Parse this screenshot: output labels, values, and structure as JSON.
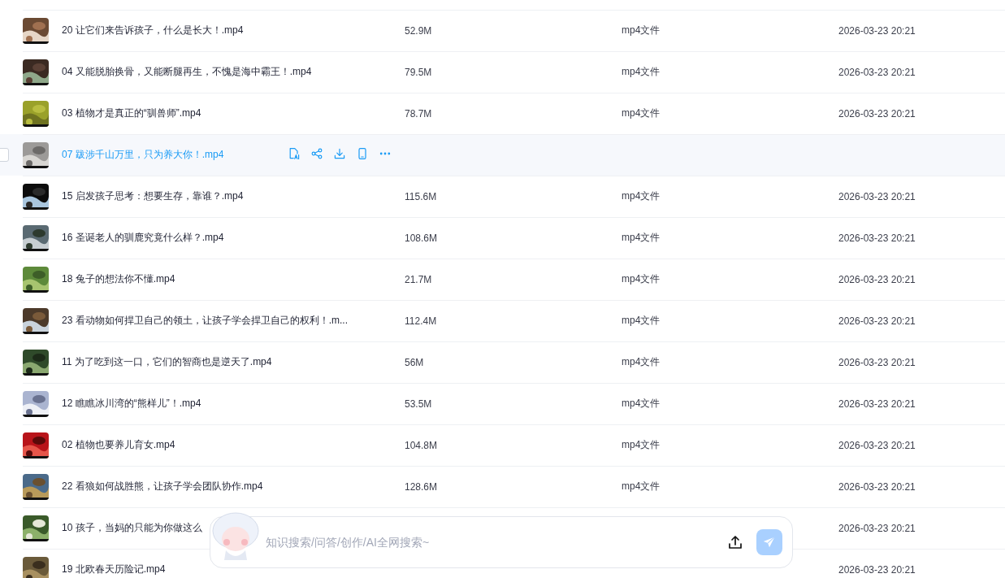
{
  "files": [
    {
      "name": "20 让它们来告诉孩子，什么是长大！.mp4",
      "size": "52.9M",
      "type": "mp4文件",
      "date": "2026-03-23 20:21",
      "hovered": false
    },
    {
      "name": "04 又能脱胎换骨，又能断腿再生，不愧是海中霸王！.mp4",
      "size": "79.5M",
      "type": "mp4文件",
      "date": "2026-03-23 20:21",
      "hovered": false
    },
    {
      "name": "03 植物才是真正的“驯兽师”.mp4",
      "size": "78.7M",
      "type": "mp4文件",
      "date": "2026-03-23 20:21",
      "hovered": false
    },
    {
      "name": "07 跋涉千山万里，只为养大你！.mp4",
      "hovered": true,
      "checked": false
    },
    {
      "name": "15 启发孩子思考：想要生存，靠谁？.mp4",
      "size": "115.6M",
      "type": "mp4文件",
      "date": "2026-03-23 20:21",
      "hovered": false
    },
    {
      "name": "16 圣诞老人的驯鹿究竟什么样？.mp4",
      "size": "108.6M",
      "type": "mp4文件",
      "date": "2026-03-23 20:21",
      "hovered": false
    },
    {
      "name": "18 兔子的想法你不懂.mp4",
      "size": "21.7M",
      "type": "mp4文件",
      "date": "2026-03-23 20:21",
      "hovered": false
    },
    {
      "name": "23 看动物如何捍卫自己的领土，让孩子学会捍卫自己的权利！.m...",
      "size": "112.4M",
      "type": "mp4文件",
      "date": "2026-03-23 20:21",
      "hovered": false
    },
    {
      "name": "11 为了吃到这一口，它们的智商也是逆天了.mp4",
      "size": "56M",
      "type": "mp4文件",
      "date": "2026-03-23 20:21",
      "hovered": false
    },
    {
      "name": "12 瞧瞧冰川湾的“熊样儿”！.mp4",
      "size": "53.5M",
      "type": "mp4文件",
      "date": "2026-03-23 20:21",
      "hovered": false
    },
    {
      "name": "02 植物也要养儿育女.mp4",
      "size": "104.8M",
      "type": "mp4文件",
      "date": "2026-03-23 20:21",
      "hovered": false
    },
    {
      "name": "22 看狼如何战胜熊，让孩子学会团队协作.mp4",
      "size": "128.6M",
      "type": "mp4文件",
      "date": "2026-03-23 20:21",
      "hovered": false
    },
    {
      "name": "10 孩子，当妈的只能为你做这么",
      "date": "2026-03-23 20:21",
      "hovered": false
    },
    {
      "name": "19 北欧春天历险记.mp4",
      "date": "2026-03-23 20:21",
      "hovered": false
    }
  ],
  "chat_bar": {
    "placeholder": "知识搜索/问答/创作/AI全网搜索~"
  }
}
